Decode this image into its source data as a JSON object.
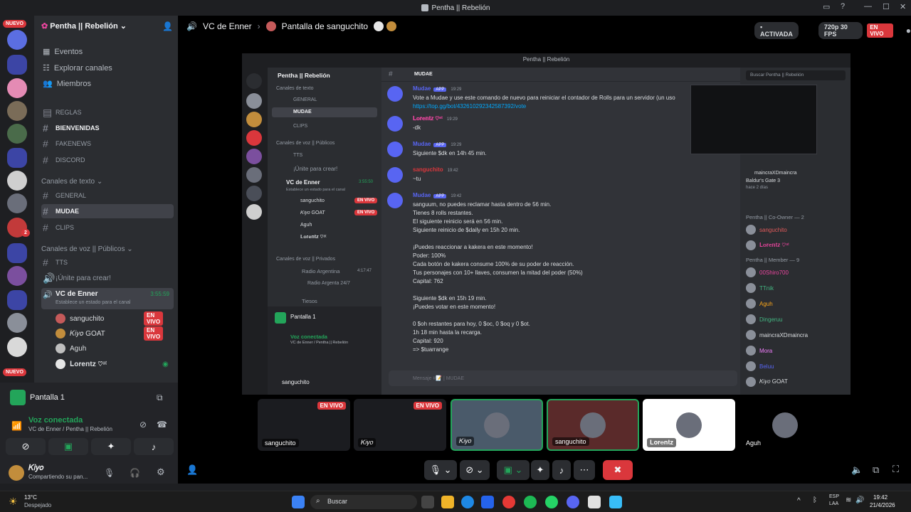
{
  "titlebar": {
    "title": "Pentha || Rebelión"
  },
  "rail": {
    "badge_top": "NUEVO",
    "badge_bottom": "NUEVO",
    "badge_mention": "2"
  },
  "sidebar": {
    "server_name": "Pentha || Rebelión",
    "nav": [
      "Eventos",
      "Explorar canales",
      "Miembros"
    ],
    "channels_top": [
      "REGLAS",
      "BIENVENIDAS",
      "FAKENEWS",
      "DISCORD"
    ],
    "cat_text": "Canales de texto",
    "text_channels": [
      "GENERAL",
      "MUDAE",
      "CLIPS"
    ],
    "cat_voice": "Canales de voz || Públicos",
    "voice_channels": [
      "TTS",
      "¡Únite para crear!"
    ],
    "vc": {
      "name": "VC de Enner",
      "time": "3:55:59",
      "status": "Establece un estado para el canal"
    },
    "vc_users": [
      {
        "name": "sanguchito",
        "badge": "EN VIVO"
      },
      {
        "name": "𝐾𝑖𝑦𝑜 GOAT",
        "badge": "EN VIVO"
      },
      {
        "name": "Aguh",
        "badge": ""
      },
      {
        "name": "𝐋𝐨𝐫𝐞𝐧𝐭𝐳 ♡ᵃᵗ",
        "badge": ""
      }
    ]
  },
  "userpanel": {
    "stream_title": "Pantalla 1",
    "voice_status": "Voz conectada",
    "voice_location": "VC de Enner / Pentha || Rebelión",
    "user_name": "𝐾𝑖𝑦𝑜",
    "user_status": "Compartiendo su pan..."
  },
  "stage_header": {
    "channel": "VC de Enner",
    "stream_title": "Pantalla de sanguchito",
    "status_activated": "ACTIVADA",
    "quality": "720p 30 FPS",
    "live": "EN VIVO"
  },
  "nested": {
    "title": "Pentha || Rebelión",
    "server_name": "Pentha || Rebelión",
    "cat_text": "Canales de texto",
    "text_channels": [
      "GENERAL",
      "MUDAE",
      "CLIPS"
    ],
    "cat_voice": "Canales de voz || Públicos",
    "voice_channels": [
      "TTS",
      "¡Únite para crear!"
    ],
    "vc_name": "VC de Enner",
    "vc_time": "3:55:50",
    "vc_status": "Establece un estado para el canal",
    "vc_users": [
      {
        "name": "sanguchito",
        "badge": "EN VIVO"
      },
      {
        "name": "𝐾𝑖𝑦𝑜 GOAT",
        "badge": "EN VIVO"
      },
      {
        "name": "Aguh",
        "badge": ""
      },
      {
        "name": "𝐋𝐨𝐫𝐞𝐧𝐭𝐳 ♡ᵃᵗ",
        "badge": ""
      }
    ],
    "cat_private": "Canales de voz || Privados",
    "private_channels": [
      {
        "name": "Radio Argentina",
        "time": "4:17:47"
      },
      {
        "name": "Radio Argenta 24/7",
        "time": ""
      },
      {
        "name": "Tiesos",
        "time": ""
      }
    ],
    "stream_title": "Pantalla 1",
    "voice_status": "Voz conectada",
    "voice_location": "VC de Enner / Pentha || Rebelión",
    "user_name": "sanguchito",
    "chat_channel": "MUDAE",
    "search_placeholder": "Buscar Pentha || Rebelión",
    "input_placeholder": "Mensaje #📝 | MUDAE",
    "messages": [
      {
        "author": "Mudae",
        "tag": "APP",
        "time": "19:29",
        "lines": [
          "Vote a Mudae y use este comando de nuevo para reiniciar el contador de Rolls para un servidor (un uso",
          "https://top.gg/bot/432610292342587392/vote"
        ]
      },
      {
        "author": "𝐋𝐨𝐫𝐞𝐧𝐭𝐳 ♡ᵃᵗ",
        "tag": "",
        "time": "19:29",
        "lines": [
          "-dk"
        ]
      },
      {
        "author": "Mudae",
        "tag": "APP",
        "time": "19:29",
        "lines": [
          "Siguiente $dk en 14h 45 min."
        ]
      },
      {
        "author": "sanguchito",
        "tag": "",
        "time": "19:42",
        "lines": [
          "~tu"
        ]
      },
      {
        "author": "Mudae",
        "tag": "APP",
        "time": "19:42",
        "lines": [
          "sanguum, no puedes reclamar hasta dentro de 56 min.",
          "Tienes 8 rolls restantes.",
          "El siguiente reinicio será en 56 min.",
          "Siguiente reinicio de $daily en 15h 20 min.",
          "",
          "¡Puedes reaccionar a kakera en este momento!",
          "Poder: 100%",
          "Cada botón de kakera consume 100% de su poder de reacción.",
          "Tus personajes con 10+ llaves, consumen la mitad del poder (50%)",
          "Capital: 762",
          "",
          "Siguiente $dk en 15h 19 min.",
          "¡Puedes votar en este momento!",
          "",
          "0 $oh restantes para hoy, 0 $oc, 0 $oq y 0 $ot.",
          "1h 18 min hasta la recarga.",
          "Capital: 920",
          "=> $tuarrange"
        ]
      }
    ],
    "activity": {
      "name": "maincraXDmaincra",
      "game": "Baldur's Gate 3",
      "ago": "hace 2 días"
    },
    "member_groups": [
      {
        "title": "Pentha || Co-Owner — 2",
        "members": [
          "sanguchito",
          "𝐋𝐨𝐫𝐞𝐧𝐭𝐳 ♡ᵃᵗ"
        ]
      },
      {
        "title": "Pentha || Member — 9",
        "members": [
          "00Shiro700",
          "TTnik",
          "Aguh",
          "Dingeruu",
          "maincraXDmaincra",
          "Mora",
          "Beluu",
          "𝐾𝑖𝑦𝑜 GOAT"
        ]
      }
    ]
  },
  "tiles": [
    {
      "name": "sanguchito",
      "live": "EN VIVO"
    },
    {
      "name": "𝐾𝑖𝑦𝑜",
      "live": "EN VIVO"
    },
    {
      "name": "𝐾𝑖𝑦𝑜",
      "live": ""
    },
    {
      "name": "sanguchito",
      "live": ""
    },
    {
      "name": "𝐋𝐨𝐫𝐞𝐧𝐭𝐳",
      "live": ""
    },
    {
      "name": "Aguh",
      "live": ""
    }
  ],
  "taskbar": {
    "weather_temp": "13°C",
    "weather_desc": "Despejado",
    "search_placeholder": "Buscar",
    "lang": "ESP",
    "lang2": "LAA",
    "time": "19:42",
    "date": "21/4/2026"
  },
  "colors": {
    "accent": "#5865f2",
    "live": "#da373c",
    "online": "#23a55a",
    "background": "#1e1f22"
  }
}
